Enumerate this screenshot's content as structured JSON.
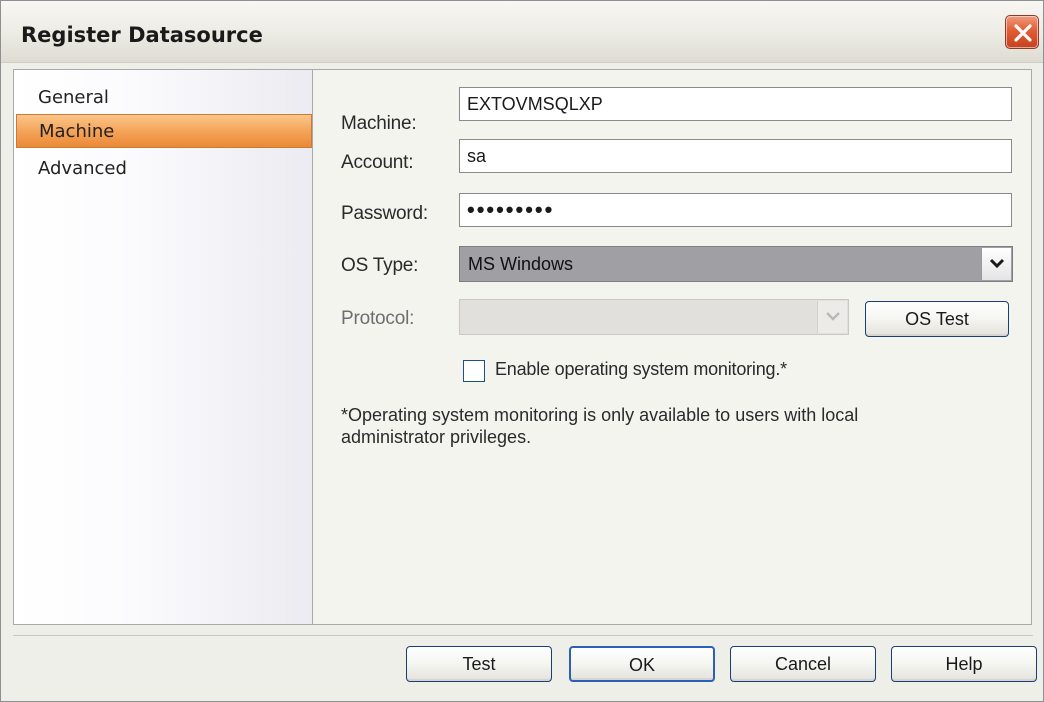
{
  "window": {
    "title": "Register Datasource"
  },
  "sidebar": {
    "items": [
      {
        "label": "General",
        "selected": false
      },
      {
        "label": "Machine",
        "selected": true
      },
      {
        "label": "Advanced",
        "selected": false
      }
    ]
  },
  "form": {
    "machine": {
      "label": "Machine:",
      "value": "EXTOVMSQLXP"
    },
    "account": {
      "label": "Account:",
      "value": "sa"
    },
    "password": {
      "label": "Password:",
      "value": "•••••••••"
    },
    "os_type": {
      "label": "OS Type:",
      "value": "MS Windows"
    },
    "protocol": {
      "label": "Protocol:",
      "value": "",
      "disabled": true
    },
    "os_test_label": "OS Test",
    "monitoring_checkbox": {
      "label": "Enable operating system monitoring.*",
      "checked": false
    },
    "note_line1": "*Operating system monitoring is only available to users with local",
    "note_line2": "administrator privileges."
  },
  "footer": {
    "test_label": "Test",
    "ok_label": "OK",
    "cancel_label": "Cancel",
    "help_label": "Help"
  },
  "colors": {
    "selection": "#f3a155",
    "close_button": "#e05d36",
    "button_border": "#1d3d74"
  }
}
